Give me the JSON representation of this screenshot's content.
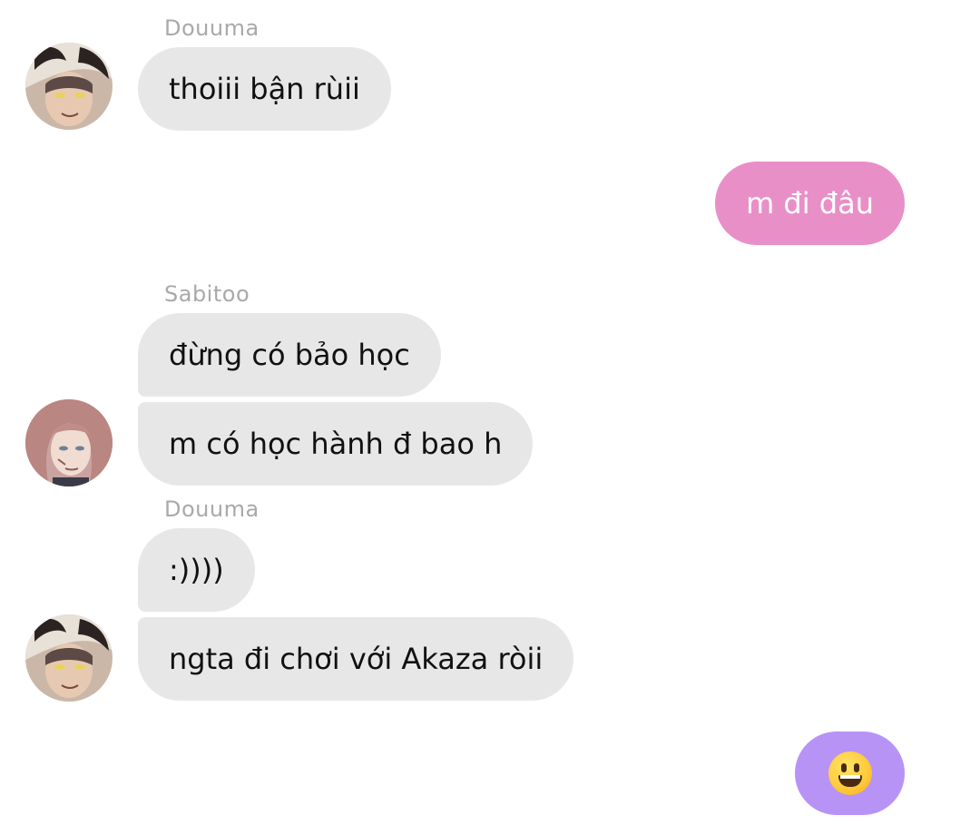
{
  "chat": {
    "messages": [
      {
        "sender": "Douuma",
        "text": "thoiii bận rùii"
      },
      {
        "text": "m đi đâu"
      },
      {
        "sender": "Sabitoo",
        "text": "đừng có bảo học"
      },
      {
        "text": "m có học hành đ bao h"
      },
      {
        "sender": "Douuma",
        "text": ":))))"
      },
      {
        "text": "ngta đi chơi với Akaza ròii"
      }
    ],
    "composer": {
      "emoji_icon": "grinning-face-emoji",
      "button_color": "#b693f5"
    }
  },
  "colors": {
    "incoming_bubble": "#e7e7e7",
    "outgoing_bubble": "#e98fc8",
    "sender_name": "#a9a9a9"
  }
}
